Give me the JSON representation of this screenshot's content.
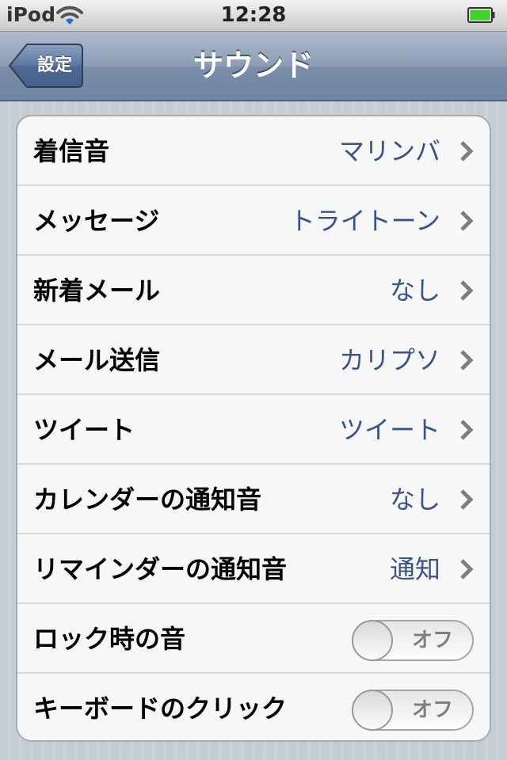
{
  "status_bar": {
    "carrier": "iPod",
    "time": "12:28",
    "wifi_icon": "wifi-icon",
    "battery_icon": "battery-icon"
  },
  "nav": {
    "back_label": "設定",
    "title": "サウンド"
  },
  "rows": [
    {
      "label": "着信音",
      "value": "マリンバ"
    },
    {
      "label": "メッセージ",
      "value": "トライトーン"
    },
    {
      "label": "新着メール",
      "value": "なし"
    },
    {
      "label": "メール送信",
      "value": "カリプソ"
    },
    {
      "label": "ツイート",
      "value": "ツイート"
    },
    {
      "label": "カレンダーの通知音",
      "value": "なし"
    },
    {
      "label": "リマインダーの通知音",
      "value": "通知"
    }
  ],
  "toggles": [
    {
      "label": "ロック時の音",
      "state": "オフ"
    },
    {
      "label": "キーボードのクリック",
      "state": "オフ"
    }
  ],
  "colors": {
    "value_text": "#385487",
    "nav_bar": "#6d84a2",
    "background": "#c5ccd4",
    "battery": "#3fd02b"
  }
}
